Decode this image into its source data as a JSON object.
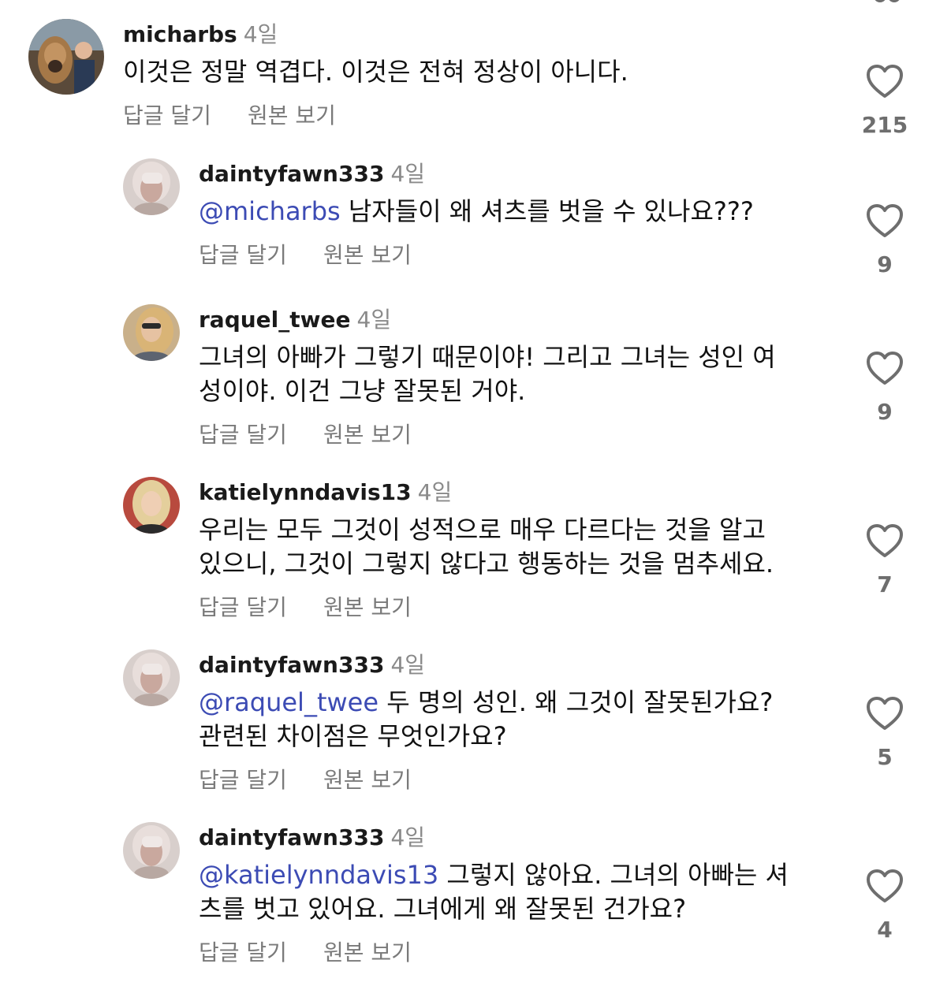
{
  "comments": [
    {
      "username": "micharbs",
      "time": "4일",
      "mention": "",
      "text_line1": "이것은 정말 역겹다. 이것은 전혀 정상이 아니다.",
      "text_line2": "",
      "reply_label": "답글 달기",
      "original_label": "원본 보기",
      "likes": "215"
    },
    {
      "username": "daintyfawn333",
      "time": "4일",
      "mention": "@micharbs",
      "text_line1": " 남자들이 왜 셔츠를 벗을 수 있나요???",
      "text_line2": "",
      "reply_label": "답글 달기",
      "original_label": "원본 보기",
      "likes": "9"
    },
    {
      "username": "raquel_twee",
      "time": "4일",
      "mention": "",
      "text_line1": "그녀의 아빠가 그렇기 때문이야! 그리고 그녀는 성인 여",
      "text_line2": "성이야. 이건 그냥 잘못된 거야.",
      "reply_label": "답글 달기",
      "original_label": "원본 보기",
      "likes": "9"
    },
    {
      "username": "katielynndavis13",
      "time": "4일",
      "mention": "",
      "text_line1": "우리는 모두 그것이 성적으로 매우 다르다는 것을 알고",
      "text_line2": "있으니, 그것이 그렇지 않다고 행동하는 것을 멈추세요.",
      "reply_label": "답글 달기",
      "original_label": "원본 보기",
      "likes": "7"
    },
    {
      "username": "daintyfawn333",
      "time": "4일",
      "mention": "@raquel_twee",
      "text_line1": " 두 명의 성인. 왜 그것이 잘못된가요?",
      "text_line2": "관련된 차이점은 무엇인가요?",
      "reply_label": "답글 달기",
      "original_label": "원본 보기",
      "likes": "5"
    },
    {
      "username": "daintyfawn333",
      "time": "4일",
      "mention": "@katielynndavis13",
      "text_line1": " 그렇지 않아요. 그녀의 아빠는 셔",
      "text_line2": "츠를 벗고 있어요. 그녀에게 왜 잘못된 건가요?",
      "reply_label": "답글 달기",
      "original_label": "원본 보기",
      "likes": "4"
    }
  ],
  "icons": {
    "like": "heart-outline-icon"
  },
  "colors": {
    "mention": "#3c4bb4",
    "muted": "#7a7a7a",
    "text": "#111111"
  }
}
